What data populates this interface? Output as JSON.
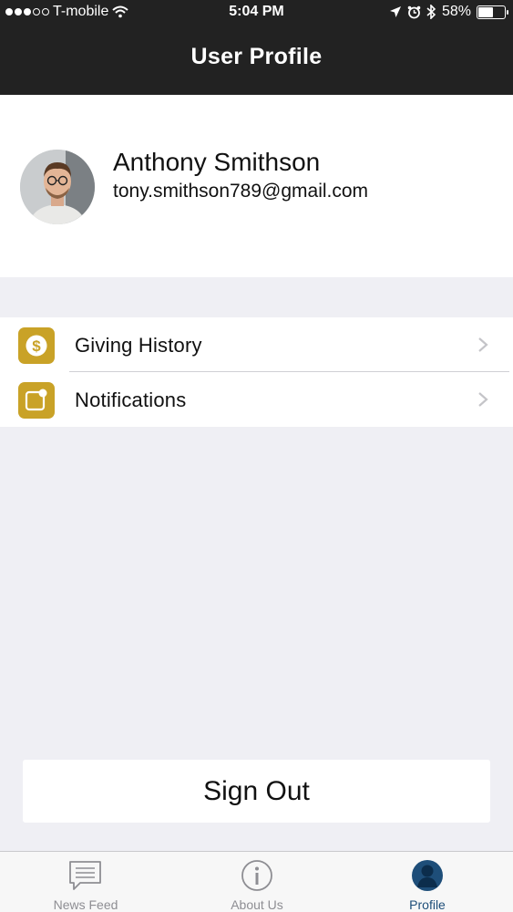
{
  "status_bar": {
    "carrier": "T-mobile",
    "time": "5:04 PM",
    "battery": "58%",
    "battery_level": 0.58
  },
  "nav": {
    "title": "User Profile"
  },
  "profile": {
    "name": "Anthony Smithson",
    "email": "tony.smithson789@gmail.com"
  },
  "menu": {
    "items": [
      {
        "label": "Giving History",
        "icon": "dollar-coin-icon"
      },
      {
        "label": "Notifications",
        "icon": "notification-badge-icon"
      }
    ]
  },
  "signout": {
    "label": "Sign Out"
  },
  "tabs": [
    {
      "label": "News Feed",
      "icon": "chat-bubble-icon",
      "active": false
    },
    {
      "label": "About Us",
      "icon": "info-icon",
      "active": false
    },
    {
      "label": "Profile",
      "icon": "person-icon",
      "active": true
    }
  ],
  "colors": {
    "nav_bg": "#222222",
    "accent_gold": "#c9a227",
    "active_tab": "#1e4e79",
    "inactive_tab": "#8e8e93",
    "background": "#efeff4"
  }
}
